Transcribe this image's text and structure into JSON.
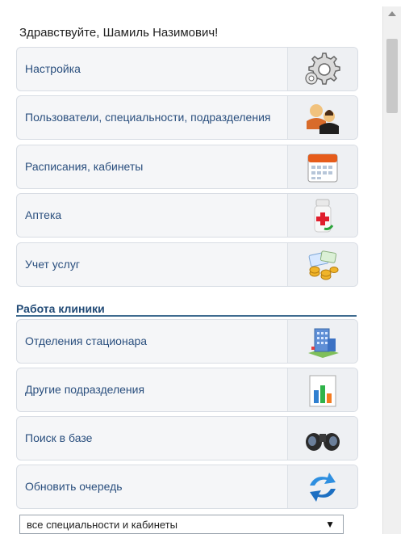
{
  "greeting": "Здравствуйте, Шамиль Назимович!",
  "menu_items": [
    {
      "label": "Настройка",
      "icon": "gear-icon"
    },
    {
      "label": "Пользователи, специальности, подразделения",
      "icon": "users-icon"
    },
    {
      "label": "Расписания, кабинеты",
      "icon": "calendar-icon"
    },
    {
      "label": "Аптека",
      "icon": "medicine-bottle-icon"
    },
    {
      "label": "Учет услуг",
      "icon": "coins-icon"
    }
  ],
  "section": {
    "title": "Работа клиники",
    "items": [
      {
        "label": "Отделения стационара",
        "icon": "hospital-building-icon"
      },
      {
        "label": "Другие подразделения",
        "icon": "bar-chart-icon"
      },
      {
        "label": "Поиск в базе",
        "icon": "binoculars-icon"
      },
      {
        "label": "Обновить очередь",
        "icon": "refresh-arrows-icon"
      }
    ]
  },
  "filter_select": {
    "selected": "все специальности и кабинеты",
    "arrow": "▼"
  },
  "colors": {
    "link": "#2a4f7e",
    "section_title": "#214a76",
    "section_line": "#3e6b8f",
    "item_bg": "#f5f6f8"
  }
}
